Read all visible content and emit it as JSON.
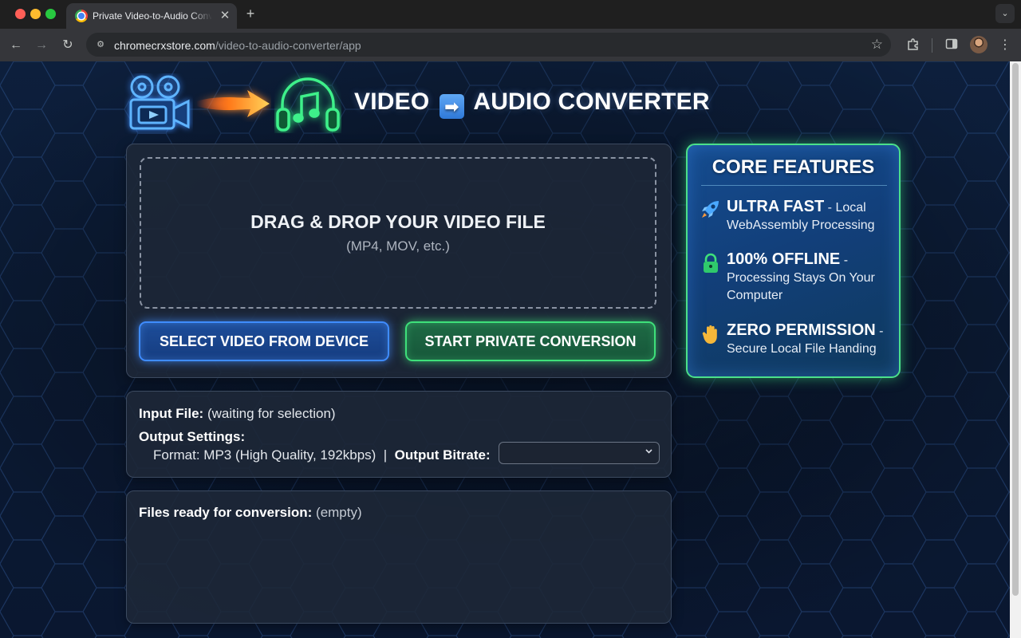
{
  "browser": {
    "tab_title": "Private Video-to-Audio Converter",
    "url_host": "chromecrxstore.com",
    "url_path": "/video-to-audio-converter/app"
  },
  "hero": {
    "title_left": "VIDEO",
    "title_arrow": "➡",
    "title_right": "AUDIO CONVERTER"
  },
  "upload": {
    "drop_title": "DRAG & DROP YOUR VIDEO FILE",
    "drop_subtitle": "(MP4, MOV, etc.)",
    "select_button": "SELECT VIDEO FROM DEVICE",
    "start_button": "START PRIVATE CONVERSION"
  },
  "settings": {
    "input_label": "Input File:",
    "input_value": "(waiting for selection)",
    "output_label": "Output Settings:",
    "format_text": "Format: MP3 (High Quality, 192kbps)",
    "separator": "|",
    "bitrate_label": "Output Bitrate:",
    "bitrate_value": ""
  },
  "files": {
    "label": "Files ready for conversion:",
    "value": "(empty)"
  },
  "features": {
    "title": "CORE FEATURES",
    "items": [
      {
        "icon": "rocket-icon",
        "head": "ULTRA FAST",
        "dash": " - ",
        "text": "Local WebAssembly Processing"
      },
      {
        "icon": "lock-icon",
        "head": "100% OFFLINE",
        "dash": " - ",
        "text": "Processing Stays On Your Computer"
      },
      {
        "icon": "hand-icon",
        "head": "ZERO PERMISSION",
        "dash": " - ",
        "text": "Secure Local File Handing"
      }
    ]
  },
  "colors": {
    "page_bg": "#0b1a33",
    "select_accent": "#3f8cff",
    "start_accent": "#3ee07a",
    "feature_border": "#4be08a"
  }
}
